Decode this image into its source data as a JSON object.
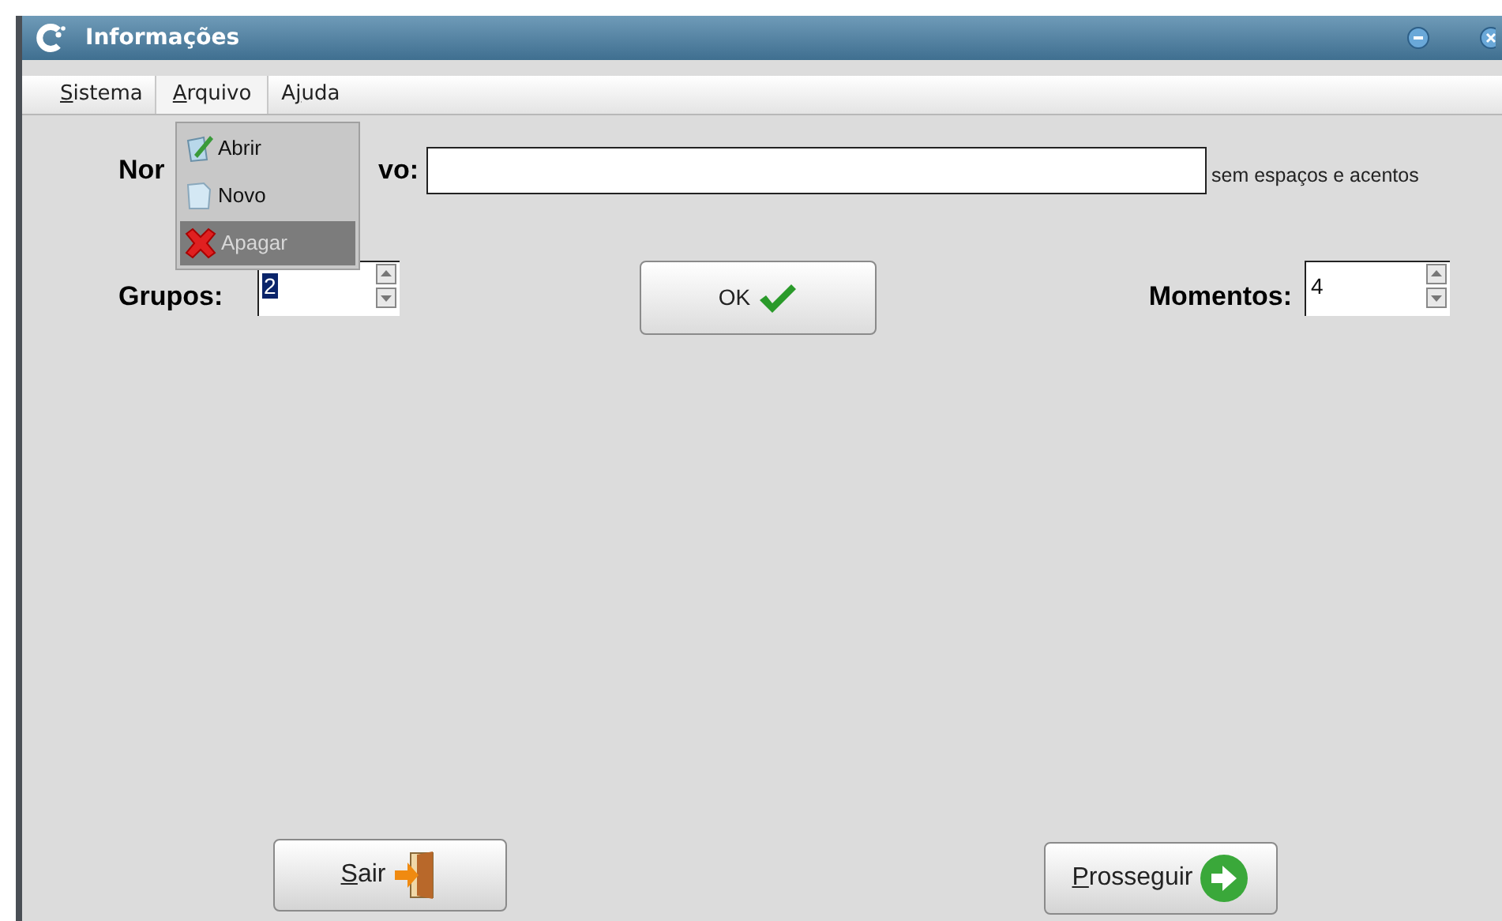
{
  "window": {
    "title": "Informações"
  },
  "menu": [
    {
      "key": "S",
      "after": "istema",
      "selected": false
    },
    {
      "key": "A",
      "after": "rquivo",
      "selected": true
    },
    {
      "before": "A",
      "key": "j",
      "after": "uda",
      "selected": false
    }
  ],
  "dropdown": [
    {
      "label": "Abrir",
      "kind": "open",
      "selected": false
    },
    {
      "label": "Novo",
      "kind": "new",
      "selected": false
    },
    {
      "label": "Apagar",
      "kind": "delete",
      "selected": true
    }
  ],
  "name_label_parts": [
    "Nor",
    "vo:"
  ],
  "name_field": {
    "hint_after": "sem espaços e acentos"
  },
  "groups": {
    "label": "Grupos:",
    "value": "2",
    "value_selected": true
  },
  "ok_button": {
    "label": "OK"
  },
  "moments": {
    "label": "Momentos:",
    "value": "4",
    "value_selected": false
  },
  "buttons": [
    {
      "kind": "exit",
      "key": "S",
      "after": "air"
    },
    {
      "kind": "next",
      "key": "P",
      "after": "rosseguir"
    }
  ]
}
